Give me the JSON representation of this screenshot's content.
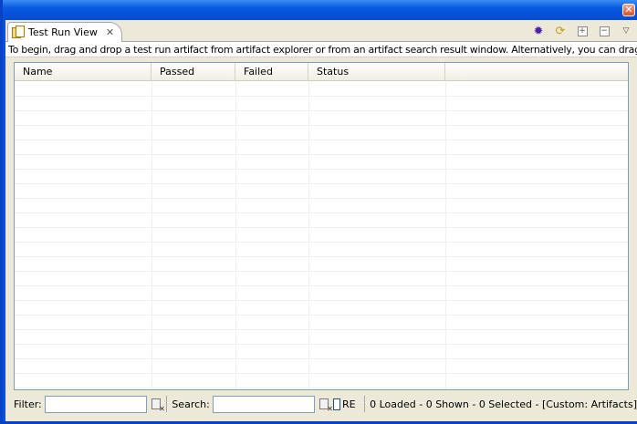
{
  "window": {
    "close_symbol": "✕"
  },
  "tab": {
    "label": "Test Run View",
    "close_symbol": "✕",
    "icon": "test-run-view-icon"
  },
  "toolbar": {
    "icons": [
      "bug-icon",
      "sync-icon",
      "maximize-icon",
      "minimize-icon",
      "view-menu-icon"
    ]
  },
  "instructions": "To begin, drag and drop a test run artifact from artifact explorer or from an artifact search result window. Alternatively, you can drag and drop",
  "table": {
    "columns": [
      "Name",
      "Passed",
      "Failed",
      "Status"
    ],
    "rows": []
  },
  "bottombar": {
    "filter_label": "Filter:",
    "filter_value": "",
    "search_label": "Search:",
    "search_value": "",
    "re_label": "RE",
    "re_checked": false,
    "status": "0 Loaded - 0 Shown - 0 Selected - [Custom: Artifacts]"
  },
  "colors": {
    "titlebar": "#0a5ae0",
    "client_bg": "#ece9d8",
    "table_border": "#7f9db9"
  }
}
